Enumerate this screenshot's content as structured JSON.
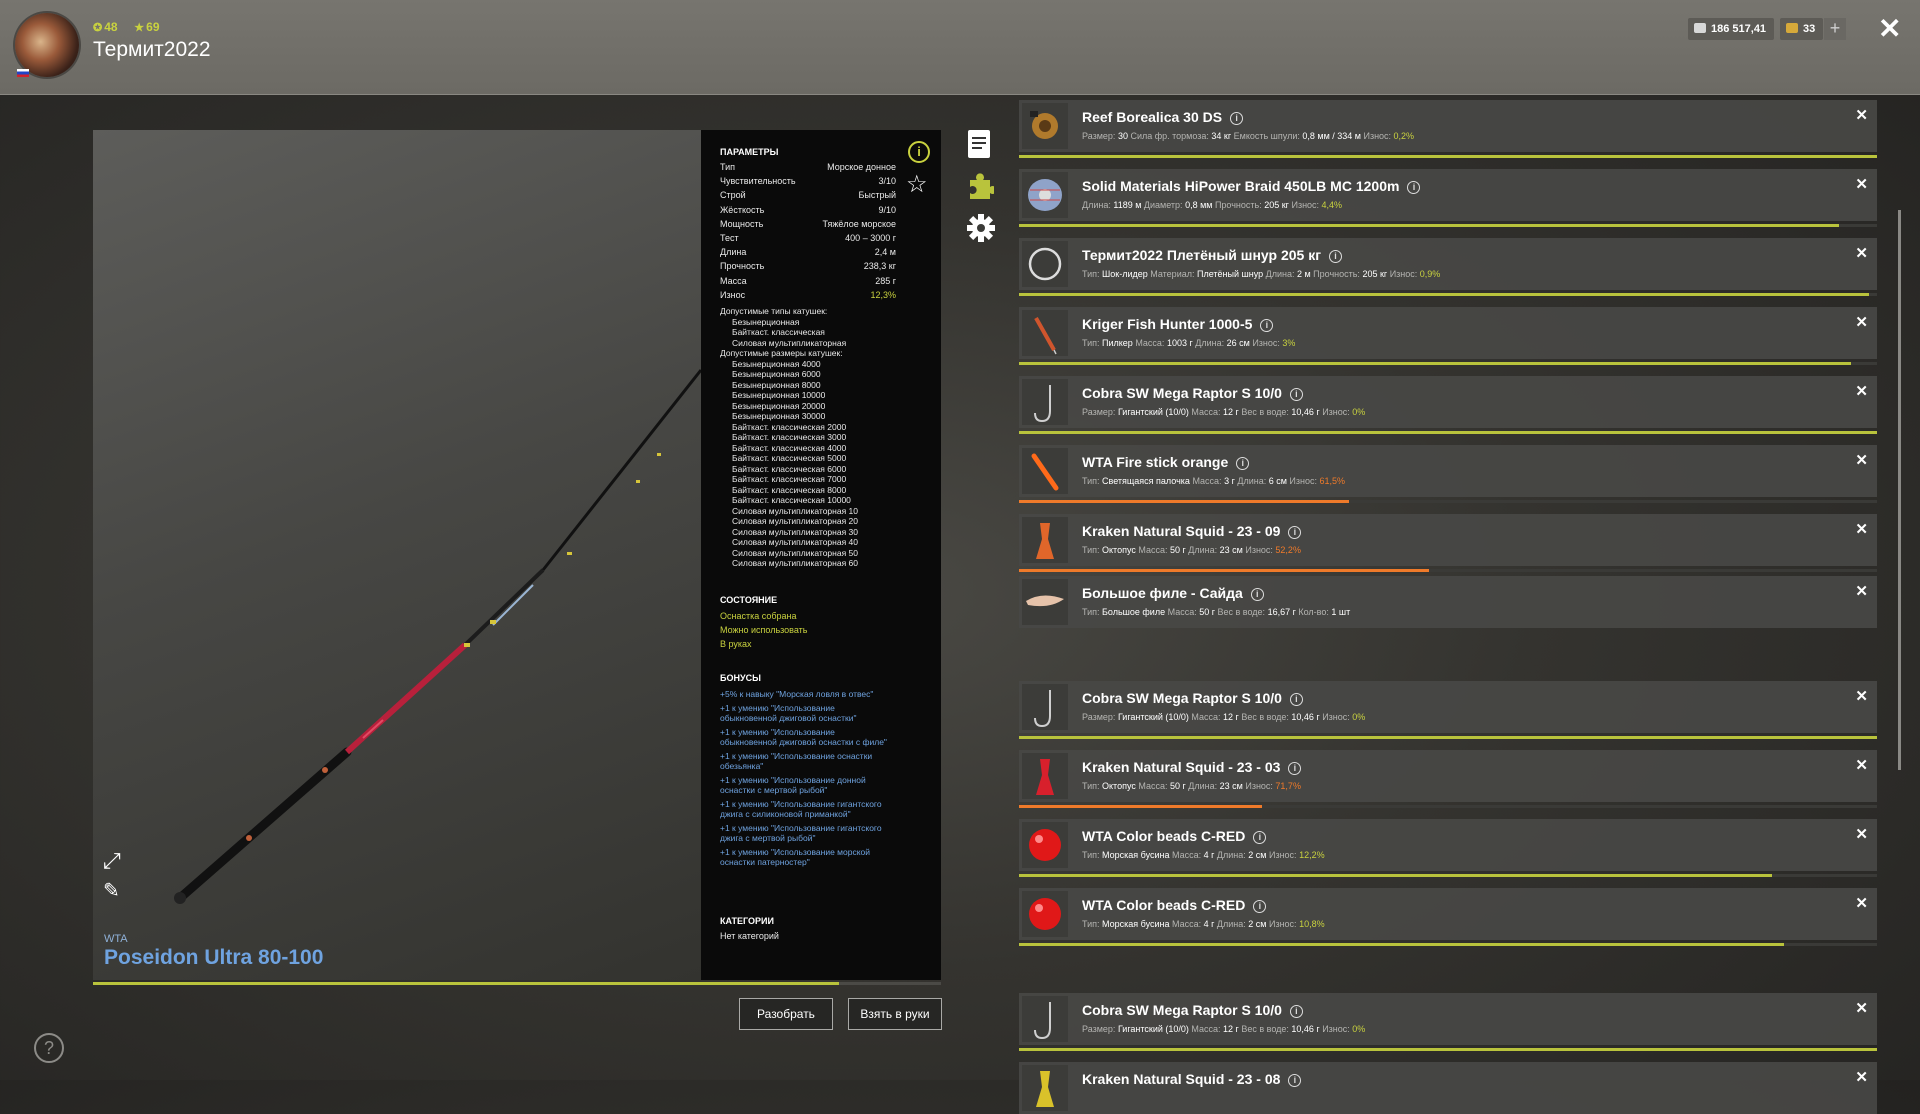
{
  "player": {
    "level": "48",
    "stars": "69",
    "name": "Термит2022"
  },
  "currency": {
    "silver": "186 517,41",
    "gold": "33"
  },
  "rod": {
    "brand": "WTA",
    "name": "Poseidon Ultra 80-100"
  },
  "params": {
    "heading": "ПАРАМЕТРЫ",
    "rows": [
      {
        "k": "Тип",
        "v": "Морское донное"
      },
      {
        "k": "Чувствительность",
        "v": "3/10"
      },
      {
        "k": "Строй",
        "v": "Быстрый"
      },
      {
        "k": "Жёсткость",
        "v": "9/10"
      },
      {
        "k": "Мощность",
        "v": "Тяжёлое морское"
      },
      {
        "k": "Тест",
        "v": "400 – 3000 г"
      },
      {
        "k": "Длина",
        "v": "2,4 м"
      },
      {
        "k": "Прочность",
        "v": "238,3 кг"
      },
      {
        "k": "Масса",
        "v": "285 г"
      },
      {
        "k": "Износ",
        "v": "12,3%"
      }
    ],
    "reel_types_title": "Допустимые типы катушек:",
    "reel_types": [
      "Безынерционная",
      "Байткаст. классическая",
      "Силовая мультипликаторная"
    ],
    "reel_sizes_title": "Допустимые размеры катушек:",
    "reel_sizes": [
      "Безынерционная 4000",
      "Безынерционная 6000",
      "Безынерционная 8000",
      "Безынерционная 10000",
      "Безынерционная 20000",
      "Безынерционная 30000",
      "Байткаст. классическая 2000",
      "Байткаст. классическая 3000",
      "Байткаст. классическая 4000",
      "Байткаст. классическая 5000",
      "Байткаст. классическая 6000",
      "Байткаст. классическая 7000",
      "Байткаст. классическая 8000",
      "Байткаст. классическая 10000",
      "Силовая мультипликаторная 10",
      "Силовая мультипликаторная 20",
      "Силовая мультипликаторная 30",
      "Силовая мультипликаторная 40",
      "Силовая мультипликаторная 50",
      "Силовая мультипликаторная 60"
    ],
    "state_heading": "СОСТОЯНИЕ",
    "state": [
      "Оснастка собрана",
      "Можно использовать",
      "В руках"
    ],
    "bonus_heading": "БОНУСЫ",
    "bonuses": [
      "+5% к навыку \"Морская ловля в отвес\"",
      "+1 к умению \"Использование обыкновенной джиговой оснастки\"",
      "+1 к умению \"Использование обыкновенной джиговой оснастки с филе\"",
      "+1 к умению \"Использование оснастки обезьянка\"",
      "+1 к умению \"Использование донной оснастки с мертвой рыбой\"",
      "+1 к умению \"Использование гигантского джига с силиконовой приманкой\"",
      "+1 к умению \"Использование гигантского джига с мертвой рыбой\"",
      "+1 к умению \"Использование морской оснастки патерностер\""
    ],
    "cat_heading": "КАТЕГОРИИ",
    "categories": "Нет категорий"
  },
  "buttons": {
    "disassemble": "Разобрать",
    "take": "Взять в руки"
  },
  "items": [
    {
      "name": "Reef Borealica 30 DS",
      "thumb": "reel",
      "details": [
        [
          "Размер:",
          "30"
        ],
        [
          "Сила фр. тормоза:",
          "34 кг"
        ],
        [
          "Емкость шпули:",
          "0,8 мм / 334 м"
        ]
      ],
      "wear": "0,2%",
      "wear_color": "green",
      "durability": 1.0
    },
    {
      "name": "Solid Materials HiPower Braid 450LB MC 1200m",
      "thumb": "spool",
      "details": [
        [
          "Длина:",
          "1189 м"
        ],
        [
          "Диаметр:",
          "0,8 мм"
        ],
        [
          "Прочность:",
          "205 кг"
        ]
      ],
      "wear": "4,4%",
      "wear_color": "green",
      "durability": 0.956
    },
    {
      "name": "Термит2022 Плетёный шнур 205 кг",
      "thumb": "coil",
      "details": [
        [
          "Тип:",
          "Шок-лидер"
        ],
        [
          "Материал:",
          "Плетёный шнур"
        ],
        [
          "Длина:",
          "2 м"
        ],
        [
          "Прочность:",
          "205 кг"
        ]
      ],
      "wear": "0,9%",
      "wear_color": "green",
      "durability": 0.991
    },
    {
      "name": "Kriger Fish Hunter 1000-5",
      "thumb": "pilker",
      "details": [
        [
          "Тип:",
          "Пилкер"
        ],
        [
          "Масса:",
          "1003 г"
        ],
        [
          "Длина:",
          "26 см"
        ]
      ],
      "wear": "3%",
      "wear_color": "green",
      "durability": 0.97
    },
    {
      "name": "Cobra SW Mega Raptor S 10/0",
      "thumb": "hook",
      "details": [
        [
          "Размер:",
          "Гигантский (10/0)"
        ],
        [
          "Масса:",
          "12 г"
        ],
        [
          "Вес в воде:",
          "10,46 г"
        ]
      ],
      "wear": "0%",
      "wear_color": "green",
      "durability": 1.0
    },
    {
      "name": "WTA Fire stick orange",
      "thumb": "stick",
      "details": [
        [
          "Тип:",
          "Светящаяся палочка"
        ],
        [
          "Масса:",
          "3 г"
        ],
        [
          "Длина:",
          "6 см"
        ]
      ],
      "wear": "61,5%",
      "wear_color": "orange",
      "durability": 0.385
    },
    {
      "name": "Kraken Natural Squid - 23 - 09",
      "thumb": "squid-orange",
      "details": [
        [
          "Тип:",
          "Октопус"
        ],
        [
          "Масса:",
          "50 г"
        ],
        [
          "Длина:",
          "23 см"
        ]
      ],
      "wear": "52,2%",
      "wear_color": "orange",
      "durability": 0.478
    },
    {
      "name": "Большое филе - Сайда",
      "thumb": "fillet",
      "details": [
        [
          "Тип:",
          "Большое филе"
        ],
        [
          "Масса:",
          "50 г"
        ],
        [
          "Вес в воде:",
          "16,67 г"
        ],
        [
          "Кол-во:",
          "1 шт"
        ]
      ],
      "wear": "",
      "wear_color": "",
      "durability": null
    },
    {
      "name": "Cobra SW Mega Raptor S 10/0",
      "thumb": "hook",
      "details": [
        [
          "Размер:",
          "Гигантский (10/0)"
        ],
        [
          "Масса:",
          "12 г"
        ],
        [
          "Вес в воде:",
          "10,46 г"
        ]
      ],
      "wear": "0%",
      "wear_color": "green",
      "durability": 1.0
    },
    {
      "name": "Kraken Natural Squid - 23 - 03",
      "thumb": "squid-red",
      "details": [
        [
          "Тип:",
          "Октопус"
        ],
        [
          "Масса:",
          "50 г"
        ],
        [
          "Длина:",
          "23 см"
        ]
      ],
      "wear": "71,7%",
      "wear_color": "orange",
      "durability": 0.283
    },
    {
      "name": "WTA Color beads C-RED",
      "thumb": "bead",
      "details": [
        [
          "Тип:",
          "Морская бусина"
        ],
        [
          "Масса:",
          "4 г"
        ],
        [
          "Длина:",
          "2 см"
        ]
      ],
      "wear": "12,2%",
      "wear_color": "green",
      "durability": 0.878
    },
    {
      "name": "WTA Color beads C-RED",
      "thumb": "bead",
      "details": [
        [
          "Тип:",
          "Морская бусина"
        ],
        [
          "Масса:",
          "4 г"
        ],
        [
          "Длина:",
          "2 см"
        ]
      ],
      "wear": "10,8%",
      "wear_color": "green",
      "durability": 0.892
    },
    {
      "name": "Cobra SW Mega Raptor S 10/0",
      "thumb": "hook",
      "details": [
        [
          "Размер:",
          "Гигантский (10/0)"
        ],
        [
          "Масса:",
          "12 г"
        ],
        [
          "Вес в воде:",
          "10,46 г"
        ]
      ],
      "wear": "0%",
      "wear_color": "green",
      "durability": 1.0
    },
    {
      "name": "Kraken Natural Squid - 23 - 08",
      "thumb": "squid-yellow",
      "details": [],
      "wear": "",
      "wear_color": "",
      "durability": null
    }
  ],
  "wear_label": "Износ:",
  "colors": {
    "accent_green": "#c9d23f",
    "accent_orange": "#ef7a2a",
    "link_blue": "#6fa3e0"
  },
  "icons": [
    "profile-avatar",
    "silver-coin-icon",
    "gold-coin-icon",
    "plus-icon",
    "close-icon",
    "expand-icon",
    "paint-icon",
    "info-icon",
    "star-icon",
    "notes-icon",
    "puzzle-icon",
    "gear-icon",
    "help-icon"
  ]
}
